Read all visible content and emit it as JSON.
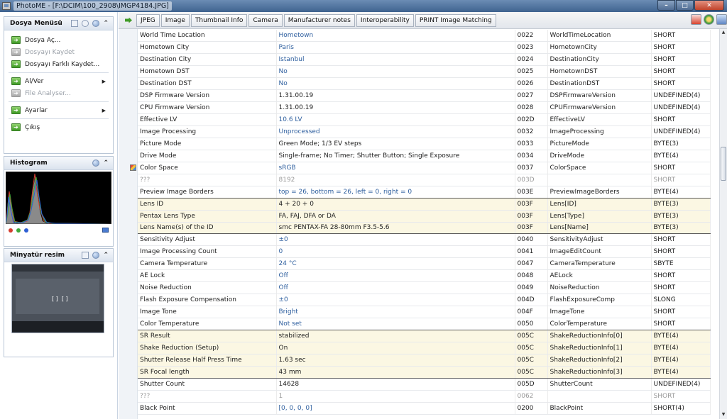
{
  "window": {
    "title": "PhotoME - [F:\\DCIM\\100_2908\\IMGP4184.JPG]",
    "minimize": "–",
    "maximize": "□",
    "close": "✕"
  },
  "menu_panel": {
    "title": "Dosya Menüsü",
    "items": [
      {
        "label": "Dosya Aç...",
        "enabled": true
      },
      {
        "label": "Dosyayı Kaydet",
        "enabled": false
      },
      {
        "label": "Dosyayı Farklı Kaydet...",
        "enabled": true
      },
      {
        "label": "Al/Ver",
        "enabled": true,
        "submenu": true
      },
      {
        "label": "File Analyser...",
        "enabled": false
      },
      {
        "label": "Ayarlar",
        "enabled": true,
        "submenu": true
      },
      {
        "label": "Çıkış",
        "enabled": true
      }
    ]
  },
  "histogram_panel": {
    "title": "Histogram",
    "channel_colors": [
      "#d43c2f",
      "#3fa83a",
      "#2e5fd4"
    ]
  },
  "thumbnail_panel": {
    "title": "Minyatür resim",
    "focus_marks": "[ ]  [ ]"
  },
  "tabs": [
    "JPEG",
    "Image",
    "Thumbnail Info",
    "Camera",
    "Manufacturer notes",
    "Interoperability",
    "PRINT Image Matching"
  ],
  "toolbar_icons": [
    "pdf-icon",
    "globe-icon",
    "screen-icon"
  ],
  "rows": [
    {
      "name": "World Time Location",
      "value": "Hometown",
      "tag": "0022",
      "field": "WorldTimeLocation",
      "type": "SHORT"
    },
    {
      "name": "Hometown City",
      "value": "Paris",
      "tag": "0023",
      "field": "HometownCity",
      "type": "SHORT"
    },
    {
      "name": "Destination City",
      "value": "Istanbul",
      "tag": "0024",
      "field": "DestinationCity",
      "type": "SHORT"
    },
    {
      "name": "Hometown DST",
      "value": "No",
      "tag": "0025",
      "field": "HometownDST",
      "type": "SHORT"
    },
    {
      "name": "Destination DST",
      "value": "No",
      "tag": "0026",
      "field": "DestinationDST",
      "type": "SHORT"
    },
    {
      "name": "DSP Firmware Version",
      "value": "1.31.00.19",
      "tag": "0027",
      "field": "DSPFirmwareVersion",
      "type": "UNDEFINED(4)",
      "plain": true
    },
    {
      "name": "CPU Firmware Version",
      "value": "1.31.00.19",
      "tag": "0028",
      "field": "CPUFirmwareVersion",
      "type": "UNDEFINED(4)",
      "plain": true
    },
    {
      "name": "Effective LV",
      "value": "10.6 LV",
      "tag": "002D",
      "field": "EffectiveLV",
      "type": "SHORT"
    },
    {
      "name": "Image Processing",
      "value": "Unprocessed",
      "tag": "0032",
      "field": "ImageProcessing",
      "type": "UNDEFINED(4)"
    },
    {
      "name": "Picture Mode",
      "value": "Green Mode; 1/3 EV steps",
      "tag": "0033",
      "field": "PictureMode",
      "type": "BYTE(3)",
      "plain": true
    },
    {
      "name": "Drive Mode",
      "value": "Single-frame; No Timer; Shutter Button; Single Exposure",
      "tag": "0034",
      "field": "DriveMode",
      "type": "BYTE(4)",
      "plain": true
    },
    {
      "name": "Color Space",
      "value": "sRGB",
      "tag": "0037",
      "field": "ColorSpace",
      "type": "SHORT",
      "icon": true
    },
    {
      "name": "???",
      "value": "8192",
      "tag": "003D",
      "field": "",
      "type": "SHORT",
      "unknown": true
    },
    {
      "name": "Preview Image Borders",
      "value": "top = 26, bottom = 26, left = 0, right = 0",
      "tag": "003E",
      "field": "PreviewImageBorders",
      "type": "BYTE(4)",
      "sep": true
    },
    {
      "name": "Lens ID",
      "value": "4 + 20 + 0",
      "tag": "003F",
      "field": "Lens[ID]",
      "type": "BYTE(3)",
      "hl": true,
      "plain": true
    },
    {
      "name": "Pentax Lens Type",
      "value": "FA, FAJ, DFA or DA",
      "tag": "003F",
      "field": "Lens[Type]",
      "type": "BYTE(3)",
      "hl": true,
      "plain": true
    },
    {
      "name": "Lens Name(s) of the ID",
      "value": "smc PENTAX-FA 28-80mm F3.5-5.6",
      "tag": "003F",
      "field": "Lens[Name]",
      "type": "BYTE(3)",
      "hl": true,
      "plain": true,
      "sep": true
    },
    {
      "name": "Sensitivity Adjust",
      "value": "±0",
      "tag": "0040",
      "field": "SensitivityAdjust",
      "type": "SHORT"
    },
    {
      "name": "Image Processing Count",
      "value": "0",
      "tag": "0041",
      "field": "ImageEditCount",
      "type": "SHORT"
    },
    {
      "name": "Camera Temperature",
      "value": "24 °C",
      "tag": "0047",
      "field": "CameraTemperature",
      "type": "SBYTE"
    },
    {
      "name": "AE Lock",
      "value": "Off",
      "tag": "0048",
      "field": "AELock",
      "type": "SHORT"
    },
    {
      "name": "Noise Reduction",
      "value": "Off",
      "tag": "0049",
      "field": "NoiseReduction",
      "type": "SHORT"
    },
    {
      "name": "Flash Exposure Compensation",
      "value": "±0",
      "tag": "004D",
      "field": "FlashExposureComp",
      "type": "SLONG"
    },
    {
      "name": "Image Tone",
      "value": "Bright",
      "tag": "004F",
      "field": "ImageTone",
      "type": "SHORT"
    },
    {
      "name": "Color Temperature",
      "value": "Not set",
      "tag": "0050",
      "field": "ColorTemperature",
      "type": "SHORT",
      "sep": true
    },
    {
      "name": "SR Result",
      "value": "stabilized",
      "tag": "005C",
      "field": "ShakeReductionInfo[0]",
      "type": "BYTE(4)",
      "hl": true,
      "plain": true
    },
    {
      "name": "Shake Reduction (Setup)",
      "value": "On",
      "tag": "005C",
      "field": "ShakeReductionInfo[1]",
      "type": "BYTE(4)",
      "hl": true,
      "plain": true
    },
    {
      "name": "Shutter Release Half Press Time",
      "value": "1.63 sec",
      "tag": "005C",
      "field": "ShakeReductionInfo[2]",
      "type": "BYTE(4)",
      "hl": true,
      "plain": true
    },
    {
      "name": "SR Focal length",
      "value": "43 mm",
      "tag": "005C",
      "field": "ShakeReductionInfo[3]",
      "type": "BYTE(4)",
      "hl": true,
      "plain": true,
      "sep": true
    },
    {
      "name": "Shutter Count",
      "value": "14628",
      "tag": "005D",
      "field": "ShutterCount",
      "type": "UNDEFINED(4)",
      "plain": true
    },
    {
      "name": "???",
      "value": "1",
      "tag": "0062",
      "field": "",
      "type": "SHORT",
      "unknown": true
    },
    {
      "name": "Black Point",
      "value": "[0, 0, 0, 0]",
      "tag": "0200",
      "field": "BlackPoint",
      "type": "SHORT(4)"
    }
  ]
}
